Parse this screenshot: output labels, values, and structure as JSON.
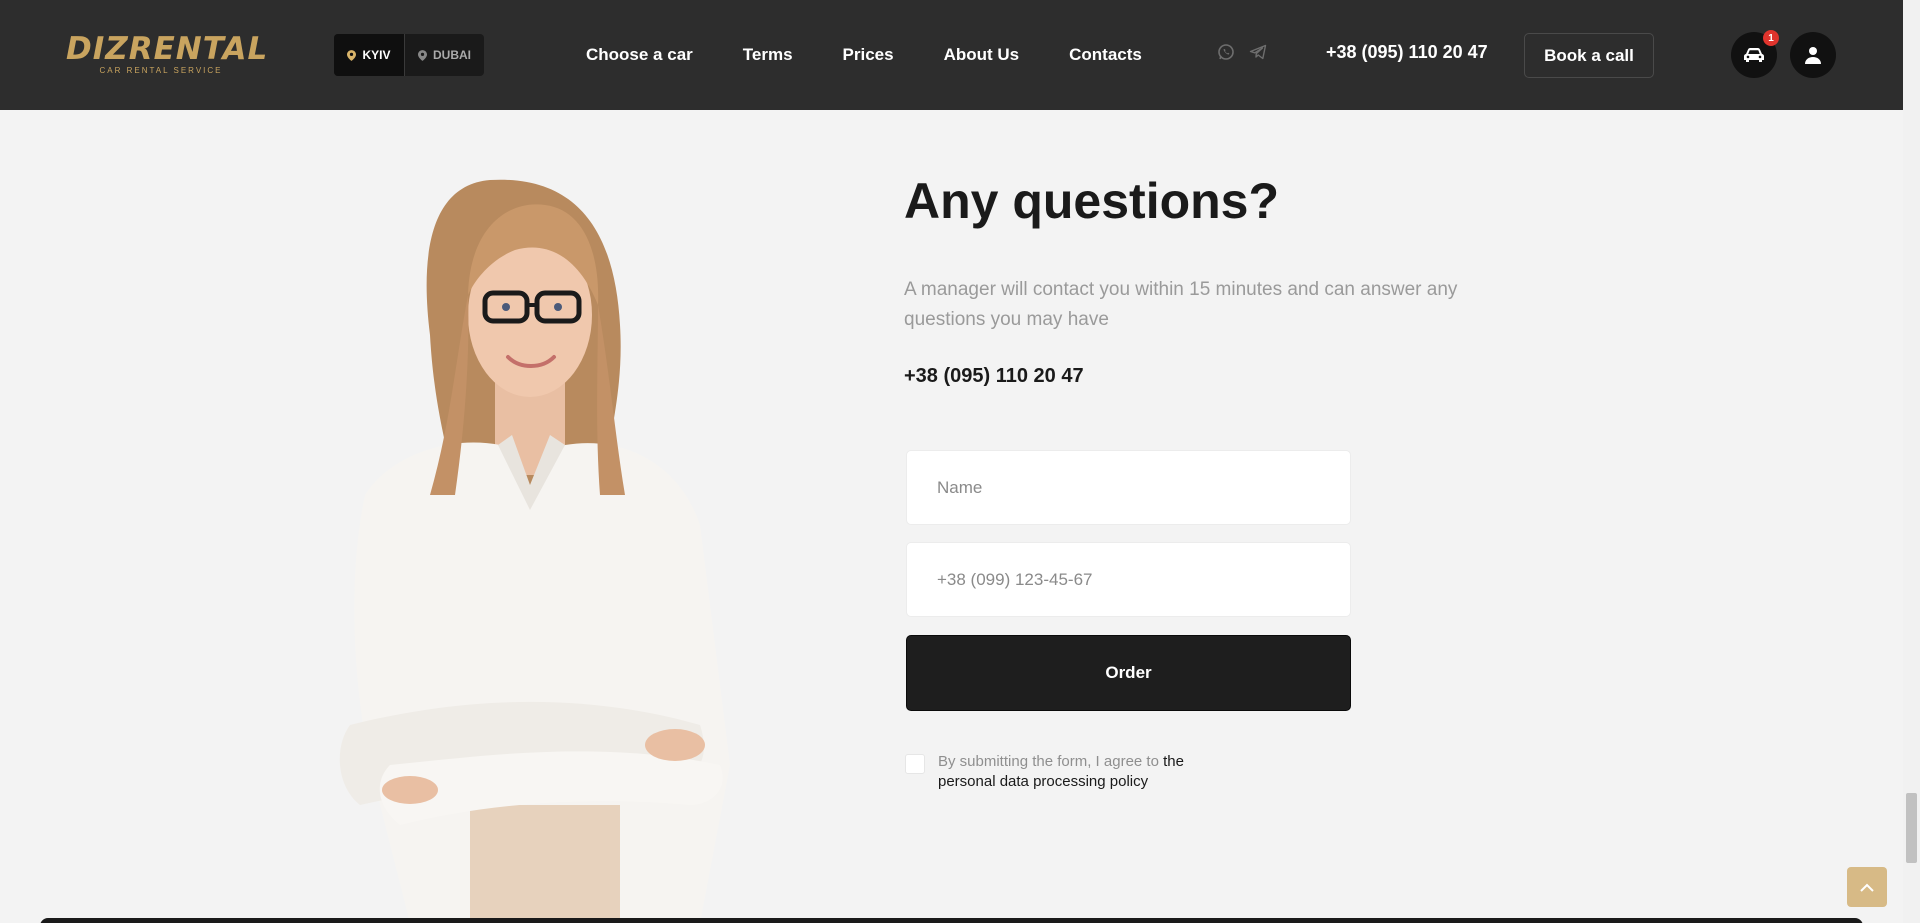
{
  "header": {
    "logo": {
      "main": "DIZRENTAL",
      "sub": "CAR RENTAL SERVICE"
    },
    "cities": [
      {
        "label": "KYIV",
        "active": true
      },
      {
        "label": "DUBAI",
        "active": false
      }
    ],
    "nav": [
      {
        "label": "Choose a car"
      },
      {
        "label": "Terms"
      },
      {
        "label": "Prices"
      },
      {
        "label": "About Us"
      },
      {
        "label": "Contacts"
      }
    ],
    "social_icons": [
      "whatsapp-icon",
      "telegram-icon"
    ],
    "phone": "+38 (095) 110 20 47",
    "book_call_label": "Book a call",
    "cars_badge": "1",
    "icons": {
      "cars": "car-icon",
      "user": "user-icon"
    }
  },
  "contact": {
    "title": "Any questions?",
    "subtitle": "A manager will contact you within 15 minutes and can answer any questions you may have",
    "phone": "+38 (095) 110 20 47",
    "name_placeholder": "Name",
    "phone_placeholder": "+38 (099) 123-45-67",
    "order_label": "Order",
    "consent_prefix": "By submitting the form, I agree to",
    "consent_link": "the personal data processing policy"
  },
  "colors": {
    "header_bg": "#2d2d2d",
    "accent_gold": "#c9a45f",
    "page_bg": "#f3f3f3",
    "button_dark": "#1e1e1e",
    "badge_red": "#e0342d"
  }
}
